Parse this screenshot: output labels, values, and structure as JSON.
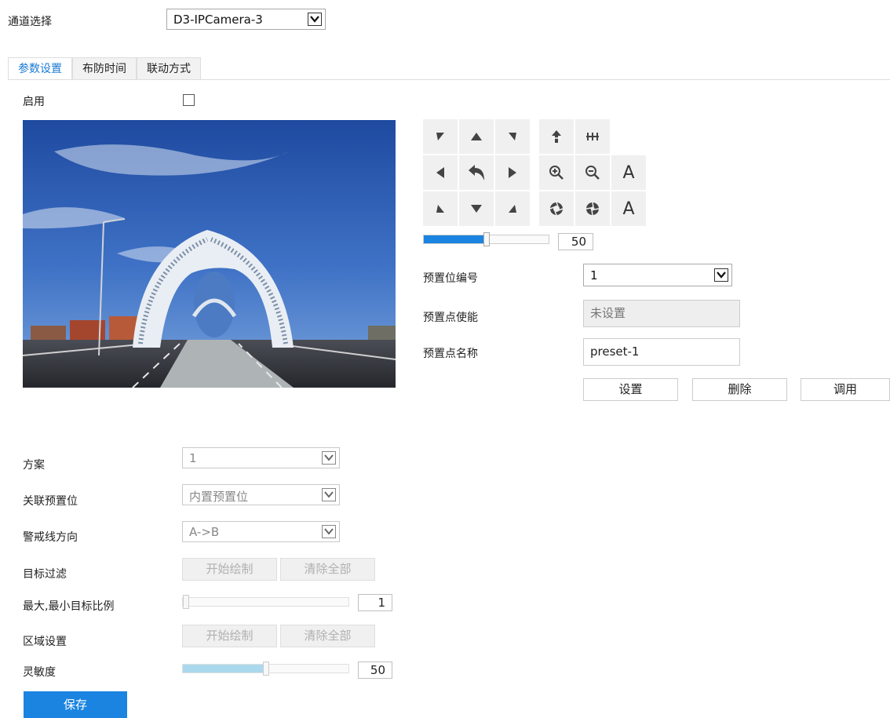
{
  "channel": {
    "label": "通道选择",
    "value": "D3-IPCamera-3"
  },
  "tabs": [
    {
      "label": "参数设置",
      "active": true
    },
    {
      "label": "布防时间",
      "active": false
    },
    {
      "label": "联动方式",
      "active": false
    }
  ],
  "enable": {
    "label": "启用",
    "checked": false
  },
  "ptz": {
    "icons": [
      "arrow-upleft-icon",
      "arrow-up-icon",
      "arrow-upright-icon",
      "focus-near-icon",
      "focus-far-icon",
      "arrow-left-icon",
      "return-home-icon",
      "arrow-right-icon",
      "zoom-in-icon",
      "zoom-out-icon",
      "auto-text",
      "arrow-downleft-icon",
      "arrow-down-icon",
      "arrow-downright-icon",
      "iris-open-icon",
      "iris-close-icon",
      "auto-text"
    ],
    "auto1": "A",
    "auto2": "A",
    "speed": "50",
    "speed_fraction": 0.5
  },
  "preset": {
    "number_label": "预置位编号",
    "number_value": "1",
    "enable_label": "预置点使能",
    "enable_value": "未设置",
    "name_label": "预置点名称",
    "name_value": "preset-1",
    "set_button": "设置",
    "delete_button": "删除",
    "call_button": "调用"
  },
  "form": {
    "scheme_label": "方案",
    "scheme_value": "1",
    "linked_preset_label": "关联预置位",
    "linked_preset_value": "内置预置位",
    "direction_label": "警戒线方向",
    "direction_value": "A->B",
    "target_filter_label": "目标过滤",
    "start_draw": "开始绘制",
    "clear_all": "清除全部",
    "ratio_label": "最大,最小目标比例",
    "ratio_value": "1",
    "ratio_fraction": 0.0,
    "area_label": "区域设置",
    "area_start_draw": "开始绘制",
    "area_clear_all": "清除全部",
    "sensitivity_label": "灵敏度",
    "sensitivity_value": "50",
    "sensitivity_fraction": 0.5
  },
  "save_button": "保存",
  "colors": {
    "accent": "#1a84e0",
    "tab_active": "#1a7ad4",
    "slider_fill": "#1a84e0",
    "slider_fill_light": "#aad8ec"
  }
}
